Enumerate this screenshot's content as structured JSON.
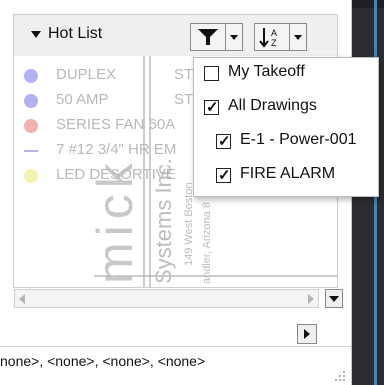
{
  "hot_list": {
    "title": "Hot List",
    "items": [
      {
        "label": "DUPLEX",
        "tag": "STD",
        "color": "#b3b3f1",
        "marker": "dot"
      },
      {
        "label": "50 AMP",
        "tag": "STD",
        "color": "#b3b3f1",
        "marker": "dot"
      },
      {
        "label": "SERIES FAN 60A",
        "tag": "",
        "color": "#f1b1b1",
        "marker": "dot"
      },
      {
        "label": "7 #12 3/4\" HR EM",
        "tag": "",
        "color": "#b8b2e6",
        "marker": "line"
      },
      {
        "label": "LED DESORTIVE",
        "tag": "",
        "color": "#f6f3b2",
        "marker": "dot"
      }
    ]
  },
  "background_drawing": {
    "large_letters": "mick",
    "line1": "Systems Inc.",
    "line2": "149 West Boston",
    "line3": "andler, Arizona 8"
  },
  "filter_menu": {
    "items": [
      {
        "label": "My Takeoff",
        "checked": false
      },
      {
        "label": "All Drawings",
        "checked": true
      },
      {
        "label": "E-1 - Power-001",
        "checked": true
      },
      {
        "label": "FIRE ALARM",
        "checked": true
      }
    ]
  },
  "status_bar": {
    "text": "none>, <none>, <none>, <none>"
  },
  "colors": {
    "sidebar_dark": "#2b2d31",
    "sidebar_accent": "#3a84c9"
  }
}
